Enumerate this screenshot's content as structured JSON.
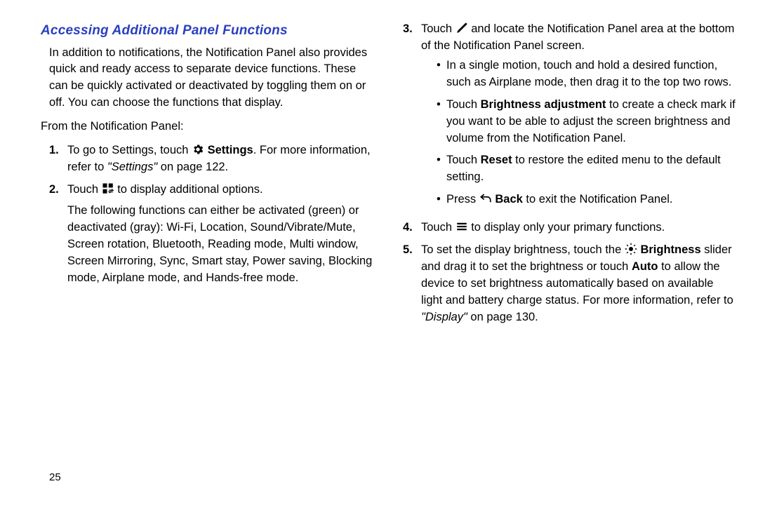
{
  "heading": "Accessing Additional Panel Functions",
  "intro": "In addition to notifications, the Notification Panel also provides quick and ready access to separate device functions. These can be quickly activated or deactivated by toggling them on or off. You can choose the functions that display.",
  "lead": "From the Notification Panel:",
  "step1_a": "To go to Settings, touch ",
  "step1_b": " Settings",
  "step1_c": ". For more information, refer to ",
  "step1_ref": "\"Settings\"",
  "step1_d": " on page 122.",
  "step2_a": "Touch ",
  "step2_b": " to display additional options.",
  "step2_para": "The following functions can either be activated (green) or deactivated (gray): Wi-Fi, Location, Sound/Vibrate/Mute, Screen rotation, Bluetooth, Reading mode, Multi window, Screen Mirroring, Sync, Smart stay, Power saving, Blocking mode, Airplane mode, and Hands-free mode.",
  "step3_a": "Touch ",
  "step3_b": " and locate the Notification Panel area at the bottom of the Notification Panel screen.",
  "step3_bullet1": "In a single motion, touch and hold a desired function, such as Airplane mode, then drag it to the top two rows.",
  "step3_bullet2_a": "Touch ",
  "step3_bullet2_b": "Brightness adjustment",
  "step3_bullet2_c": " to create a check mark if you want to be able to adjust the screen brightness and volume from the Notification Panel.",
  "step3_bullet3_a": "Touch ",
  "step3_bullet3_b": "Reset",
  "step3_bullet3_c": " to restore the edited menu to the default setting.",
  "step3_bullet4_a": "Press ",
  "step3_bullet4_b": " Back",
  "step3_bullet4_c": " to exit the Notification Panel.",
  "step4_a": "Touch ",
  "step4_b": " to display only your primary functions.",
  "step5_a": "To set the display brightness, touch the ",
  "step5_b": " Brightness",
  "step5_c": " slider and drag it to set the brightness or touch ",
  "step5_d": "Auto",
  "step5_e": " to allow the device to set brightness automatically based on available light and battery charge status. For more information, refer to ",
  "step5_ref": "\"Display\"",
  "step5_f": " on page 130.",
  "pagenum": "25"
}
